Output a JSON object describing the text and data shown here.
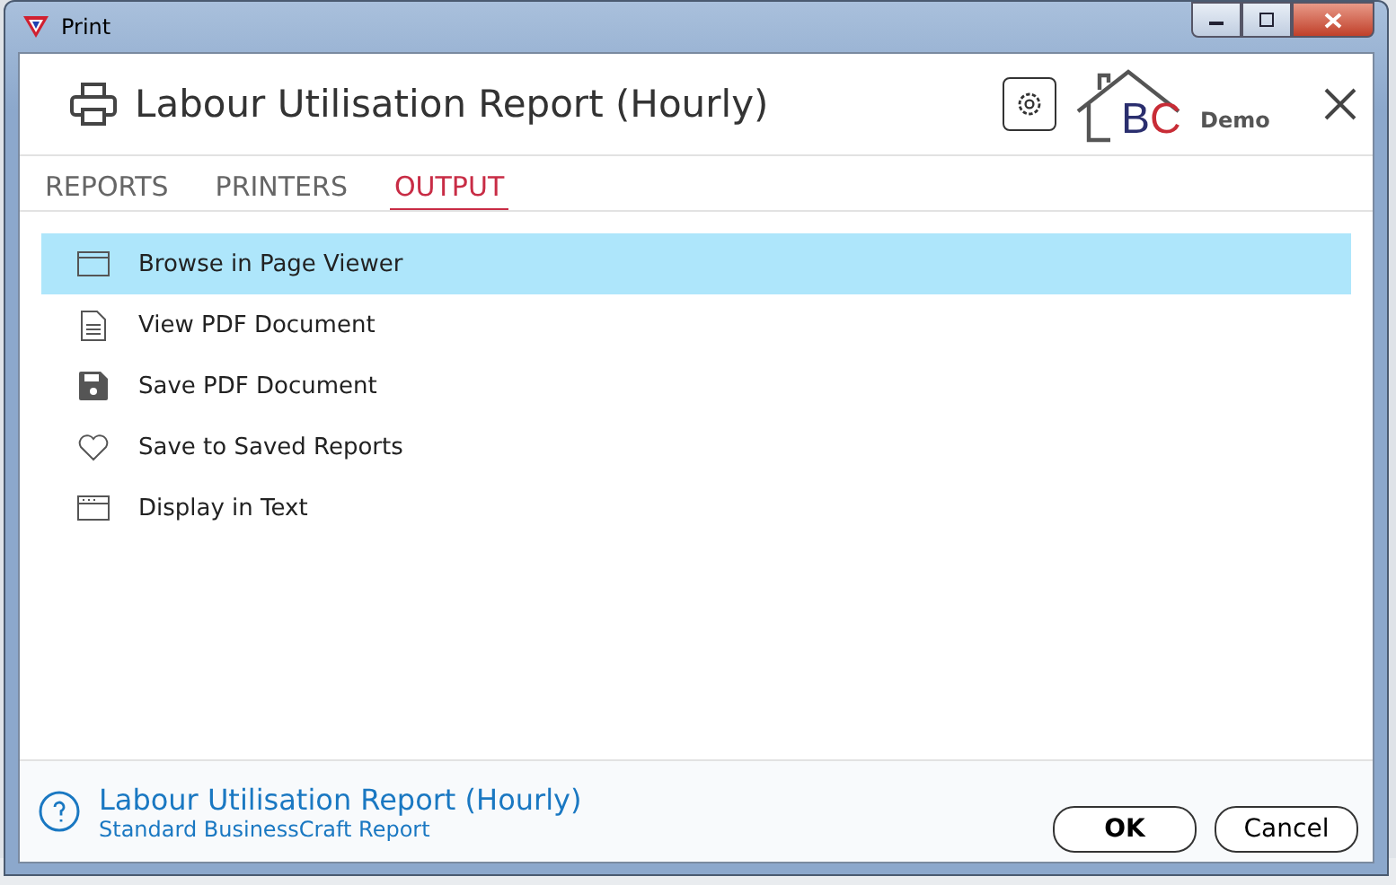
{
  "window": {
    "title": "Print"
  },
  "header": {
    "title": "Labour Utilisation Report (Hourly)",
    "logo_text": "BC",
    "edition": "Demo"
  },
  "tabs": [
    {
      "label": "REPORTS",
      "selected": false
    },
    {
      "label": "PRINTERS",
      "selected": false
    },
    {
      "label": "OUTPUT",
      "selected": true
    }
  ],
  "options": [
    {
      "kind": "browser",
      "label": "Browse in Page Viewer",
      "selected": true
    },
    {
      "kind": "document",
      "label": "View PDF Document",
      "selected": false
    },
    {
      "kind": "save",
      "label": "Save PDF Document",
      "selected": false
    },
    {
      "kind": "heart",
      "label": "Save to Saved Reports",
      "selected": false
    },
    {
      "kind": "text",
      "label": "Display in Text",
      "selected": false
    }
  ],
  "footer": {
    "title": "Labour Utilisation Report (Hourly)",
    "subtitle": "Standard BusinessCraft Report"
  },
  "buttons": [
    "OK",
    "Cancel"
  ]
}
